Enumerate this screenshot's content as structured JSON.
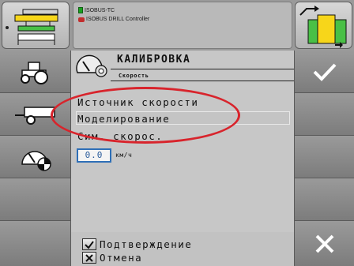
{
  "header": {
    "line1": "ISOBUS-TC",
    "line2": "ISOBUS DRILL Controller"
  },
  "panel": {
    "title": "КАЛИБРОВКА",
    "subtitle": "Скорость",
    "speed_source_label": "Источник скорости",
    "speed_source_value": "Моделирование",
    "sim_speed_label": "Сим. скорос.",
    "sim_speed_value": "0.0",
    "sim_speed_unit": "км/ч"
  },
  "footer": {
    "confirm_label": "Подтверждение",
    "cancel_label": "Отмена"
  },
  "colors": {
    "highlight": "#d8242c",
    "field_border": "#2e6fb7"
  },
  "icons": {
    "top_left": "implement-layout-icon",
    "top_right": "section-switch-icon",
    "left": [
      "tractor-icon",
      "trailer-icon",
      "speedometer-settings-icon"
    ],
    "right": [
      "checkmark-icon",
      "close-icon"
    ]
  }
}
